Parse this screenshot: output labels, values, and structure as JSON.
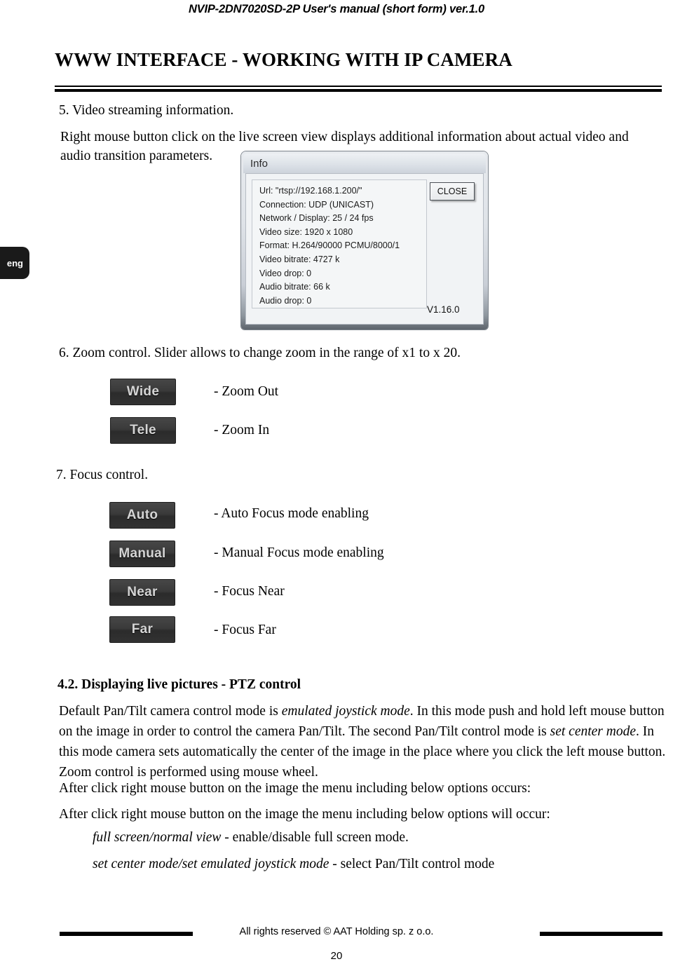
{
  "header": {
    "running_head": "NVIP-2DN7020SD-2P User's manual (short form) ver.1.0"
  },
  "lang_tab": {
    "label": "eng"
  },
  "title": "WWW INTERFACE - WORKING WITH IP CAMERA",
  "sections": {
    "item5": {
      "heading": "5.  Video streaming information.",
      "paragraph_line1": "Right mouse button click on the live screen view displays additional information about actual video and",
      "paragraph_line2": "audio transition parameters."
    },
    "item6": {
      "heading": "6. Zoom control. Slider allows to change zoom in the range of x1 to x 20.",
      "buttons": [
        {
          "caption": "Wide",
          "description": "- Zoom Out"
        },
        {
          "caption": "Tele",
          "description": "- Zoom In"
        }
      ]
    },
    "item7": {
      "heading": "7. Focus control.",
      "buttons": [
        {
          "caption": "Auto",
          "description": "- Auto Focus mode enabling"
        },
        {
          "caption": "Manual",
          "description": "- Manual Focus mode enabling"
        },
        {
          "caption": "Near",
          "description": "- Focus Near"
        },
        {
          "caption": "Far",
          "description": "- Focus Far"
        }
      ]
    },
    "item42": {
      "heading": "4.2. Displaying live pictures - PTZ control",
      "para1_a": "Default Pan/Tilt camera control mode is ",
      "para1_i1": "emulated joystick mode",
      "para1_b": ". In this mode push and hold left mouse button on the image in order to control the camera Pan/Tilt. The second Pan/Tilt control mode is ",
      "para1_i2": "set center mode",
      "para1_c": ". In this mode camera sets automatically the center of the image in the place where you click the left mouse button. Zoom control is performed using mouse wheel.",
      "para2": "After click right mouse button on the image the menu including below options occurs:",
      "para3": "After click right mouse button on the image the menu including below options will occur:",
      "option1_italic": "full screen/normal view",
      "option1_rest": " - enable/disable full screen mode.",
      "option2_italic": "set center mode/set emulated joystick mode",
      "option2_rest": " - select Pan/Tilt control mode"
    }
  },
  "info_dialog": {
    "title": "Info",
    "close_label": "CLOSE",
    "version": "V1.16.0",
    "lines": [
      "Url: \"rtsp://192.168.1.200/\"",
      "Connection: UDP (UNICAST)",
      "Network / Display:  25 / 24 fps",
      "Video size: 1920 x 1080",
      "Format: H.264/90000 PCMU/8000/1",
      "Video bitrate: 4727 k",
      "Video drop: 0",
      "Audio bitrate: 66 k",
      "Audio drop: 0"
    ]
  },
  "footer": {
    "copyright": "All rights reserved © AAT Holding sp. z o.o.",
    "page_number": "20"
  }
}
